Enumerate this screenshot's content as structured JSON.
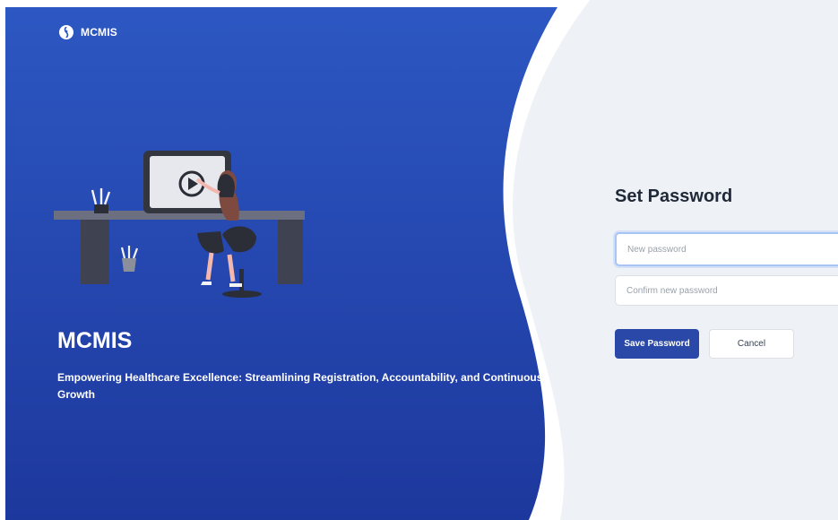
{
  "brand": {
    "name": "MCMIS",
    "logo_icon": "mcmis-logo-icon"
  },
  "hero": {
    "title": "MCMIS",
    "tagline": "Empowering Healthcare Excellence: Streamlining Registration, Accountability, and Continuous Growth",
    "illustration": "woman-watching-video-illustration"
  },
  "form": {
    "title": "Set Password",
    "new_password": {
      "placeholder": "New password",
      "value": ""
    },
    "confirm_password": {
      "placeholder": "Confirm new password",
      "value": ""
    },
    "save_label": "Save Password",
    "cancel_label": "Cancel"
  },
  "colors": {
    "hero_gradient_top": "#2c55bf",
    "hero_gradient_bottom": "#1e3a9e",
    "primary_button": "#2948a8",
    "input_focus_border": "#a7c4f5"
  }
}
